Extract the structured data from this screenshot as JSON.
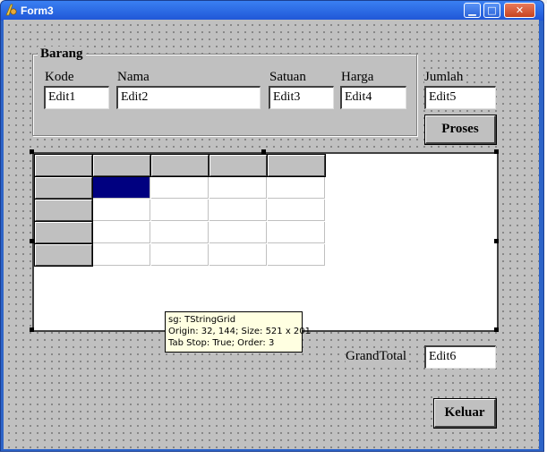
{
  "window": {
    "title": "Form3",
    "minimize_glyph": "▁",
    "maximize_glyph": "□",
    "close_glyph": "✕"
  },
  "groupbox": {
    "caption": "Barang"
  },
  "fields": {
    "kode": {
      "label": "Kode",
      "value": "Edit1"
    },
    "nama": {
      "label": "Nama",
      "value": "Edit2"
    },
    "satuan": {
      "label": "Satuan",
      "value": "Edit3"
    },
    "harga": {
      "label": "Harga",
      "value": "Edit4"
    },
    "jumlah": {
      "label": "Jumlah",
      "value": "Edit5"
    },
    "grandtotal": {
      "label": "GrandTotal",
      "value": "Edit6"
    }
  },
  "buttons": {
    "proses": "Proses",
    "keluar": "Keluar"
  },
  "grid": {
    "columns": 5,
    "rows": 5,
    "fixed_cols": 1,
    "fixed_rows": 1,
    "selected_cell": [
      1,
      1
    ]
  },
  "tooltip": {
    "line1": "sg: TStringGrid",
    "line2": "Origin: 32, 144; Size: 521 x 201",
    "line3": "Tab Stop: True; Order: 3"
  },
  "colors": {
    "client": "#c0c0c0",
    "selection": "#000080",
    "titlebar": "#2a62d6"
  }
}
